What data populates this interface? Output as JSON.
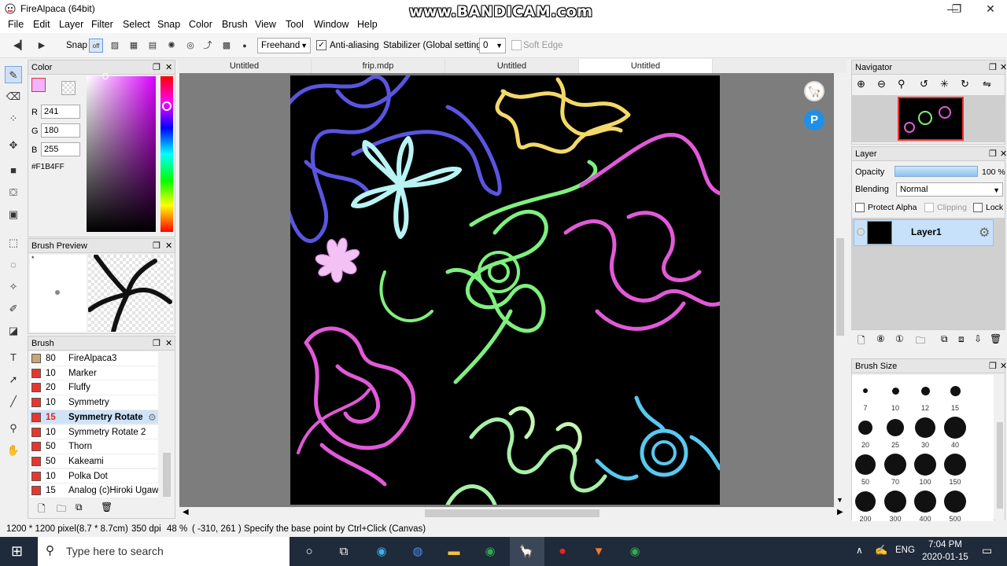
{
  "title": "FireAlpaca (64bit)",
  "watermark": "www.BANDICAM.com",
  "window_controls": {
    "minimize": "—",
    "maximize": "❐",
    "close": "✕"
  },
  "menu": [
    "File",
    "Edit",
    "Layer",
    "Filter",
    "Select",
    "Snap",
    "Color",
    "Brush",
    "View",
    "Tool",
    "Window",
    "Help"
  ],
  "toolbar": {
    "snap_label": "Snap",
    "snap_off": "off",
    "mode": "Freehand",
    "antialias_label": "Anti-aliasing",
    "antialias_checked": true,
    "stabilizer_label": "Stabilizer (Global settings)",
    "stabilizer_value": "0",
    "softedge_label": "Soft Edge"
  },
  "color_panel": {
    "title": "Color",
    "r_label": "R",
    "r": "241",
    "g_label": "G",
    "g": "180",
    "b_label": "B",
    "b": "255",
    "hex": "#F1B4FF",
    "fg_color": "#F1B4FF"
  },
  "brush_preview": {
    "title": "Brush Preview",
    "marker": "*"
  },
  "brush_panel": {
    "title": "Brush",
    "items": [
      {
        "size": "80",
        "name": "FireAlpaca3",
        "color": "#c8a774"
      },
      {
        "size": "10",
        "name": "Marker",
        "color": "#e8362e"
      },
      {
        "size": "20",
        "name": "Fluffy",
        "color": "#e8362e"
      },
      {
        "size": "10",
        "name": "Symmetry",
        "color": "#e8362e"
      },
      {
        "size": "15",
        "name": "Symmetry Rotate",
        "color": "#e8362e",
        "selected": true
      },
      {
        "size": "10",
        "name": "Symmetry Rotate 2",
        "color": "#e8362e"
      },
      {
        "size": "50",
        "name": "Thorn",
        "color": "#e8362e"
      },
      {
        "size": "50",
        "name": "Kakeami",
        "color": "#e8362e"
      },
      {
        "size": "10",
        "name": "Polka Dot",
        "color": "#e8362e"
      },
      {
        "size": "15",
        "name": "Analog (c)Hiroki Ugawa",
        "color": "#e8362e"
      }
    ]
  },
  "tabs": [
    "Untitled",
    "frip.mdp",
    "Untitled",
    "Untitled"
  ],
  "navigator": {
    "title": "Navigator"
  },
  "layer_panel": {
    "title": "Layer",
    "opacity_label": "Opacity",
    "opacity_value": "100 %",
    "opacity_fraction": 1.0,
    "blending_label": "Blending",
    "blending_value": "Normal",
    "protect_alpha": "Protect Alpha",
    "clipping": "Clipping",
    "lock": "Lock",
    "layer_name": "Layer1"
  },
  "brush_size": {
    "title": "Brush Size",
    "sizes": [
      "7",
      "10",
      "12",
      "15",
      "20",
      "25",
      "30",
      "40",
      "50",
      "70",
      "100",
      "150",
      "200",
      "300",
      "400",
      "500"
    ]
  },
  "status": {
    "size": "1200 * 1200 pixel",
    "cm": "(8.7 * 8.7cm)",
    "dpi": "350 dpi",
    "zoom": "48 %",
    "coords": "( -310, 261 )",
    "hint": "Specify the base point by Ctrl+Click (Canvas)"
  },
  "taskbar": {
    "search_placeholder": "Type here to search",
    "lang": "ENG",
    "time": "7:04 PM",
    "date": "2020-01-15"
  }
}
